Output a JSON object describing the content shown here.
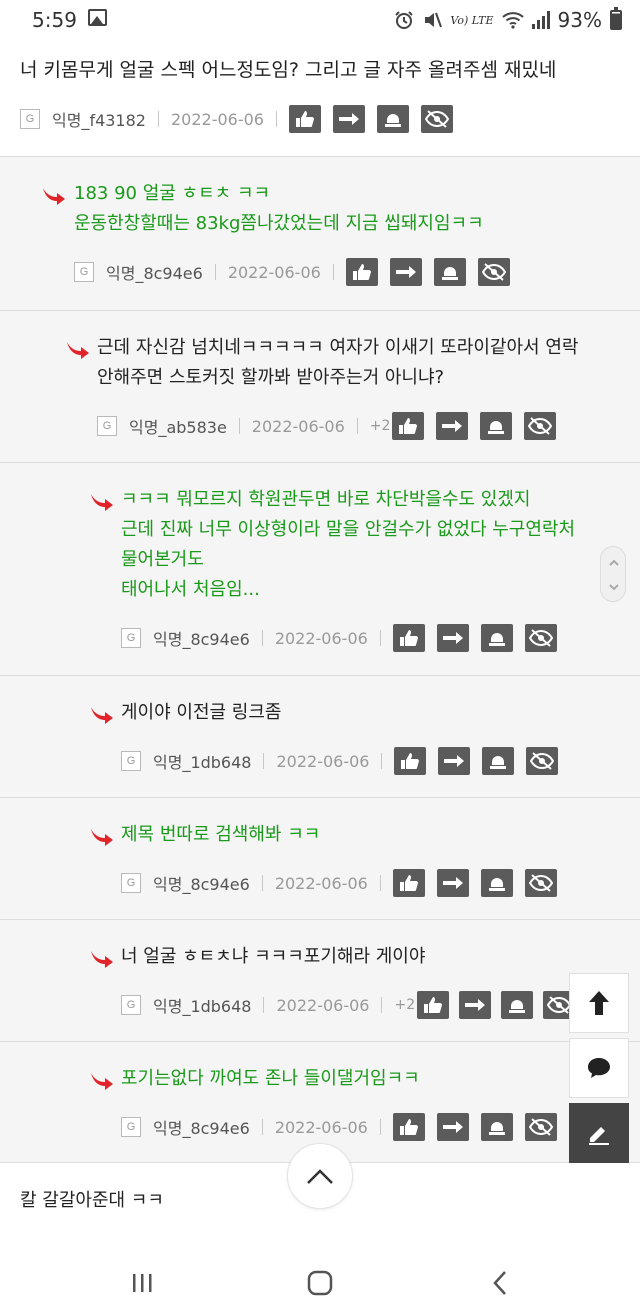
{
  "status_bar": {
    "time": "5:59",
    "battery": "93%",
    "network_label": "Vo) LTE"
  },
  "post": {
    "title": "너 키몸무게 얼굴 스펙 어느정도임? 그리고 글 자주 올려주셈 재밌네",
    "author": "익명_f43182",
    "date": "2022-06-06",
    "badge": "G"
  },
  "replies": [
    {
      "lines": [
        "183 90 얼굴 ㅎㅌㅊ ㅋㅋ",
        "운동한창할때는 83kg쯤나갔었는데 지금 씹돼지임ㅋㅋ"
      ],
      "author": "익명_8c94e6",
      "date": "2022-06-06",
      "badge": "G",
      "plus": "",
      "color": "green"
    },
    {
      "lines": [
        "근데 자신감 넘치네ㅋㅋㅋㅋㅋ 여자가 이새기 또라이같아서 연락",
        "안해주면 스토커짓 할까봐 받아주는거 아니냐?"
      ],
      "author": "익명_ab583e",
      "date": "2022-06-06",
      "badge": "G",
      "plus": "+2",
      "color": "dark"
    },
    {
      "lines": [
        "ㅋㅋㅋ 뭐모르지 학원관두면 바로 차단박을수도 있겠지",
        "근데 진짜 너무 이상형이라 말을 안걸수가 없었다 누구연락처",
        "물어본거도",
        "태어나서 처음임..."
      ],
      "author": "익명_8c94e6",
      "date": "2022-06-06",
      "badge": "G",
      "plus": "",
      "color": "green"
    },
    {
      "lines": [
        "게이야 이전글 링크좀"
      ],
      "author": "익명_1db648",
      "date": "2022-06-06",
      "badge": "G",
      "plus": "",
      "color": "dark"
    },
    {
      "lines": [
        "제목 번따로 검색해봐 ㅋㅋ"
      ],
      "author": "익명_8c94e6",
      "date": "2022-06-06",
      "badge": "G",
      "plus": "",
      "color": "green"
    },
    {
      "lines": [
        "너 얼굴 ㅎㅌㅊ냐 ㅋㅋㅋ포기해라 게이야"
      ],
      "author": "익명_1db648",
      "date": "2022-06-06",
      "badge": "G",
      "plus": "+2",
      "color": "dark"
    },
    {
      "lines": [
        "포기는없다 까여도 존나 들이댈거임ㅋㅋ"
      ],
      "author": "익명_8c94e6",
      "date": "2022-06-06",
      "badge": "G",
      "plus": "",
      "color": "green"
    }
  ],
  "last_comment": "칼 갈갈아준대 ㅋㅋ",
  "icons": {
    "like": "thumbs-up-icon",
    "share": "arrow-right-icon",
    "report": "siren-icon",
    "hide": "eye-slash-icon",
    "scroll_top": "chevron-up-icon",
    "up": "arrow-up-icon",
    "chat": "chat-bubble-icon",
    "write": "pencil-icon"
  },
  "colors": {
    "green_text": "#1a9a1a",
    "arrow_red": "#e0242a",
    "button_gray": "#5b5b5b",
    "reply_bg": "#f5f5f5"
  }
}
